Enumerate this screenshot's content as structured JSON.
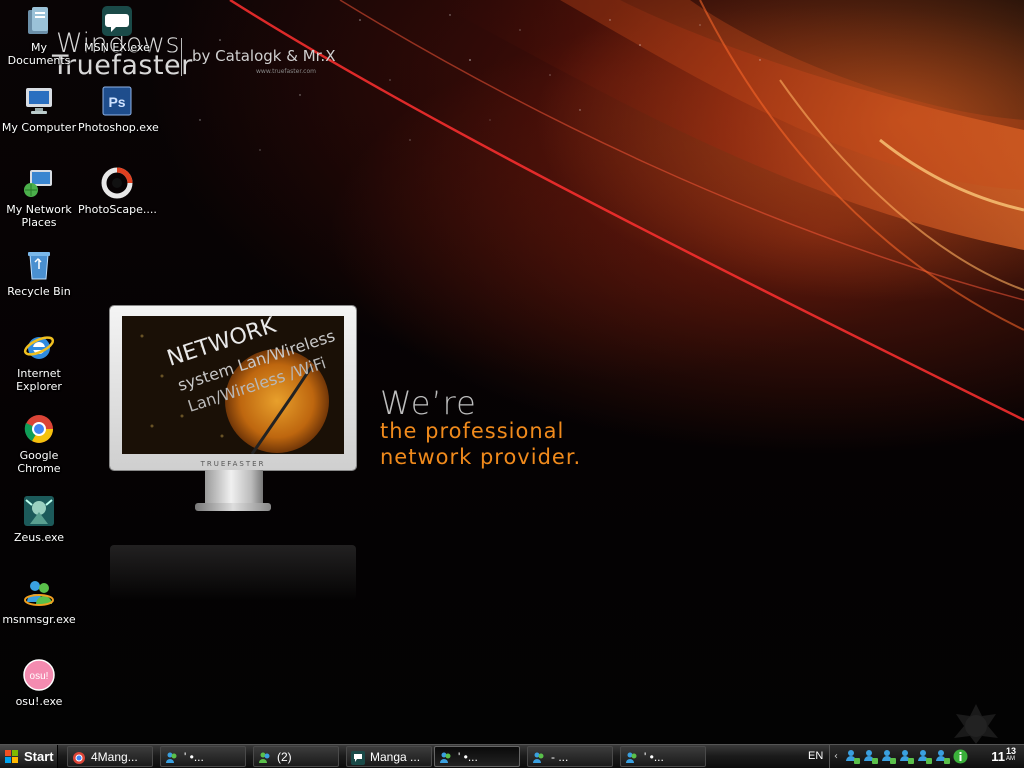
{
  "wallpaper": {
    "brand_line1": "Windows",
    "brand_line2": "Truefaster",
    "brand_by": "by Catalogk & Mr.X",
    "brand_url": "www.truefaster.com",
    "tagline_lead": "We’re",
    "tagline_line1": "the professional",
    "tagline_line2": "network provider.",
    "monitor_brand": "TRUEFASTER",
    "screen_text1": "NETWORK",
    "screen_text2": "system Lan/Wireless",
    "screen_text3": "Lan/Wireless /WiFi",
    "colors": {
      "accent_orange": "#f08a1c",
      "red_glow": "#c8321a"
    }
  },
  "desktop_icons": [
    {
      "label": "My Documents",
      "icon": "folder-icon"
    },
    {
      "label": "MSN EX.exe",
      "icon": "speech-bubble-icon"
    },
    {
      "label": "My Computer",
      "icon": "computer-icon"
    },
    {
      "label": "Photoshop.exe",
      "icon": "photoshop-icon"
    },
    {
      "label": "My Network Places",
      "icon": "network-icon"
    },
    {
      "label": "PhotoScape....",
      "icon": "photoscape-icon"
    },
    {
      "label": "Recycle Bin",
      "icon": "recycle-bin-icon"
    },
    {
      "label": "Internet Explorer",
      "icon": "ie-icon"
    },
    {
      "label": "Google Chrome",
      "icon": "chrome-icon"
    },
    {
      "label": "Zeus.exe",
      "icon": "zeus-icon"
    },
    {
      "label": "msnmsgr.exe",
      "icon": "msn-messenger-icon"
    },
    {
      "label": "osu!.exe",
      "icon": "osu-icon"
    }
  ],
  "taskbar": {
    "start_label": "Start",
    "tasks": [
      {
        "label": "4Mang...",
        "icon": "chrome-icon"
      },
      {
        "label": "'      •...",
        "icon": "msn-icon"
      },
      {
        "label": "(2)",
        "icon": "msn-icon"
      },
      {
        "label": "Manga ...",
        "icon": "speech-bubble-icon"
      },
      {
        "label": "'      •...",
        "icon": "msn-icon"
      },
      {
        "label": "-     ...",
        "icon": "msn-icon"
      },
      {
        "label": "'      •...",
        "icon": "msn-icon"
      }
    ],
    "active_task_index": 4,
    "language": "EN",
    "tray_chevron": "‹",
    "tray_icons": [
      "msn-contact-icon",
      "msn-contact-icon",
      "msn-contact-icon",
      "msn-contact-icon",
      "msn-contact-icon",
      "msn-contact-icon",
      "info-icon"
    ],
    "clock_hours": "11",
    "clock_minutes": "13",
    "clock_ampm": "AM"
  }
}
